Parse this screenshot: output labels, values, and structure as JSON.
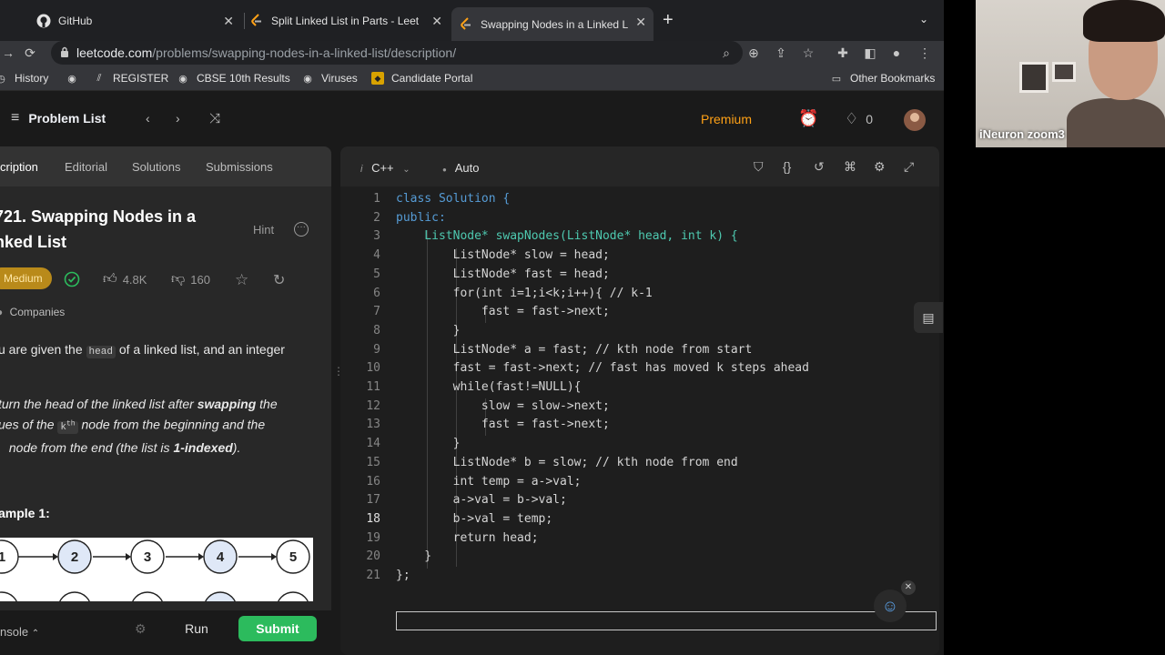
{
  "browser": {
    "tabs": [
      {
        "title": "GitHub",
        "favicon": "github-icon"
      },
      {
        "title": "Split Linked List in Parts - Leet",
        "favicon": "leetcode-icon"
      },
      {
        "title": "Swapping Nodes in a Linked Li",
        "favicon": "leetcode-icon",
        "active": true
      }
    ],
    "url_host": "leetcode.com",
    "url_path": "/problems/swapping-nodes-in-a-linked-list/description/",
    "bookmarks": [
      "History",
      "REGISTER",
      "CBSE 10th Results",
      "Viruses",
      "Candidate Portal"
    ],
    "other_bookmarks": "Other Bookmarks"
  },
  "lc_nav": {
    "problem_list": "Problem List",
    "premium": "Premium",
    "streak": "0"
  },
  "left_panel": {
    "tabs": [
      "cription",
      "Editorial",
      "Solutions",
      "Submissions"
    ],
    "title_line1": "721. Swapping Nodes in a",
    "title_line2": "nked List",
    "hint": "Hint",
    "difficulty": "Medium",
    "likes": "4.8K",
    "dislikes": "160",
    "companies": "Companies",
    "desc1_pre": "u are given the",
    "desc1_code": "head",
    "desc1_post": "of a linked list, and an integer",
    "desc2_line1_a": "turn the head of the linked list after",
    "desc2_line1_b": "swapping",
    "desc2_line1_c": "the",
    "desc2_line2_a": "ues of the",
    "desc2_line2_code": "k",
    "desc2_line2_sup": "th",
    "desc2_line2_b": "node from the beginning and the",
    "desc2_line3_a": "node from the end (the list is",
    "desc2_line3_b": "1-indexed",
    "desc2_line3_c": ").",
    "example_title": "ample 1:",
    "diagram_nodes": [
      "1",
      "2",
      "3",
      "4",
      "5"
    ]
  },
  "bottom_bar": {
    "console": "nsole",
    "run": "Run",
    "submit": "Submit"
  },
  "editor": {
    "language": "C++",
    "autocomplete": "Auto",
    "current_line": 18
  },
  "code_lines": [
    "class Solution {",
    "public:",
    "    ListNode* swapNodes(ListNode* head, int k) {",
    "        ListNode* slow = head;",
    "        ListNode* fast = head;",
    "        for(int i=1;i<k;i++){ // k-1",
    "            fast = fast->next;",
    "        }",
    "        ListNode* a = fast; // kth node from start",
    "        fast = fast->next; // fast has moved k steps ahead",
    "        while(fast!=NULL){",
    "            slow = slow->next;",
    "            fast = fast->next;",
    "        }",
    "        ListNode* b = slow; // kth node from end",
    "        int temp = a->val;",
    "        a->val = b->val;",
    "        b->val = temp;",
    "        return head;",
    "    }",
    "};"
  ],
  "webcam": {
    "label": "iNeuron zoom3"
  },
  "colors": {
    "accent_orange": "#ffa116",
    "submit_green": "#2cbb5d",
    "difficulty": "#b98a1a"
  }
}
